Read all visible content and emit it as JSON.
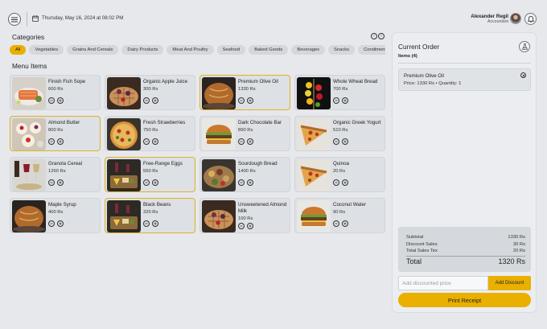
{
  "header": {
    "date_text": "Thursday, May 16, 2024 at 08:02 PM",
    "user_name": "Alexander Regil",
    "user_role": "Accountant"
  },
  "categories": {
    "title": "Categories",
    "items": [
      "All",
      "Vegetables",
      "Grains And Cereals",
      "Dairy Products",
      "Meat And Poultry",
      "Seafood",
      "Baked Goods",
      "Beverages",
      "Snacks",
      "Condiments"
    ],
    "active_index": 0
  },
  "menu": {
    "title": "Menu Items",
    "items": [
      {
        "name": "Finish Fish Sope",
        "price": "600 Rs",
        "image": "salmon-dish",
        "selected": false
      },
      {
        "name": "Organic Apple Juice",
        "price": "300 Rs",
        "image": "waffle-berries",
        "selected": false
      },
      {
        "name": "Premium Olive Oil",
        "price": "1330 Rs",
        "image": "bread-loaf",
        "selected": true
      },
      {
        "name": "Whole Wheat Bread",
        "price": "700 Rs",
        "image": "fruit-skewer",
        "selected": false
      },
      {
        "name": "Almond Butter",
        "price": "800 Rs",
        "image": "fruit-tarts",
        "selected": true
      },
      {
        "name": "Fresh Strawberries",
        "price": "750 Rs",
        "image": "pizza",
        "selected": false
      },
      {
        "name": "Dark Chocolate Bar",
        "price": "890 Rs",
        "image": "burger",
        "selected": false
      },
      {
        "name": "Organic Greek Yogurt",
        "price": "510 Rs",
        "image": "pizza-slice",
        "selected": false
      },
      {
        "name": "Granola Cereal",
        "price": "1260 Rs",
        "image": "wine-glasses",
        "selected": false
      },
      {
        "name": "Free-Range Eggs",
        "price": "550 Rs",
        "image": "cheese-platter",
        "selected": true
      },
      {
        "name": "Sourdough Bread",
        "price": "1400 Rs",
        "image": "platter",
        "selected": false
      },
      {
        "name": "Quinoa",
        "price": "20 Rs",
        "image": "pizza-slice",
        "selected": false
      },
      {
        "name": "Maple Syrup",
        "price": "400 Rs",
        "image": "bread-loaf",
        "selected": false
      },
      {
        "name": "Black Beans",
        "price": "320 Rs",
        "image": "cheese-platter",
        "selected": true
      },
      {
        "name": "Unsweetened Almond Milk",
        "price": "100 Rs",
        "image": "waffle-berries",
        "selected": false
      },
      {
        "name": "Coconut Water",
        "price": "90 Rs",
        "image": "burger",
        "selected": false
      }
    ]
  },
  "order": {
    "title": "Current Order",
    "items_label": "Items (4)",
    "items": [
      {
        "name": "Premium Olive Oil",
        "meta": "Price: 1330 Rs • Quantity: 1"
      }
    ],
    "subtotal_label": "Subtotal",
    "subtotal_value": "1330 Rs",
    "discount_label": "Discount Sales",
    "discount_value": "30 Rs",
    "tax_label": "Total Sales Tex",
    "tax_value": "20 Rs",
    "total_label": "Total",
    "total_value": "1320 Rs",
    "discount_placeholder": "Add discounted price",
    "add_discount_label": "Add Discount",
    "print_label": "Print Receipt"
  },
  "colors": {
    "accent": "#e9b000",
    "background": "#e6e8ec",
    "panel": "#ebedf0"
  },
  "icons": {
    "menu": "hamburger-icon",
    "calendar": "calendar-icon",
    "bell": "bell-icon",
    "clear": "flask-icon",
    "prev": "chevron-left-icon",
    "next": "chevron-right-icon"
  }
}
